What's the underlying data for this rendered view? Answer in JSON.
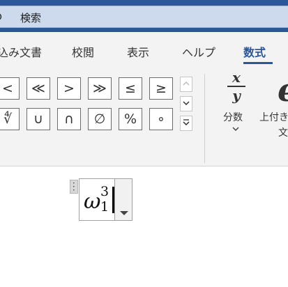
{
  "titlebar": {
    "search_label": "検索",
    "color": "#2b579a"
  },
  "tabs": [
    {
      "label": "込み文書"
    },
    {
      "label": "校閲"
    },
    {
      "label": "表示"
    },
    {
      "label": "ヘルプ"
    },
    {
      "label": "数式",
      "active": true
    }
  ],
  "symbols": {
    "row1": [
      "<",
      "≪",
      ">",
      "≫",
      "≤",
      "≥"
    ],
    "row2": [
      "∜",
      "∪",
      "∩",
      "∅",
      "%",
      "∘"
    ]
  },
  "scroll_icons": [
    "chevron-up-icon",
    "chevron-down-icon",
    "more-icon"
  ],
  "ribbon_buttons": {
    "fraction": {
      "label": "分数",
      "icon_top": "x",
      "icon_bottom": "y"
    },
    "script": {
      "label_line1": "上付き",
      "label_line2": "文",
      "icon": "e"
    }
  },
  "equation": {
    "base": "ω",
    "superscript": "3",
    "subscript": "1"
  }
}
